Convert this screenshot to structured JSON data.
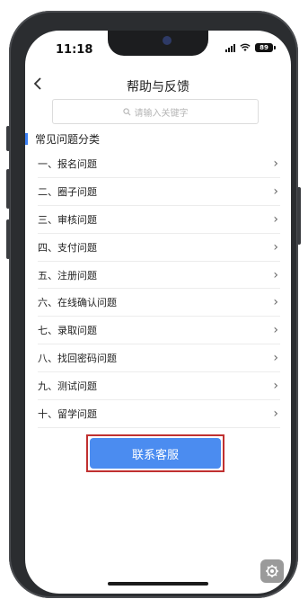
{
  "status": {
    "time": "11:18",
    "battery": "89"
  },
  "nav": {
    "back_symbol": "‹",
    "title": "帮助与反馈"
  },
  "search": {
    "placeholder": "请输入关键字"
  },
  "section": {
    "label": "常见问题分类",
    "accent": "#3b7ff5"
  },
  "categories": [
    "一、报名问题",
    "二、圈子问题",
    "三、审核问题",
    "四、支付问题",
    "五、注册问题",
    "六、在线确认问题",
    "七、录取问题",
    "八、找回密码问题",
    "九、测试问题",
    "十、留学问题"
  ],
  "contact": {
    "label": "联系客服",
    "color": "#4b8cf0",
    "highlight": "#c03030"
  },
  "icons": {
    "search": "search-icon",
    "chevron": "chevron-right-icon",
    "settings": "gear-icon"
  }
}
